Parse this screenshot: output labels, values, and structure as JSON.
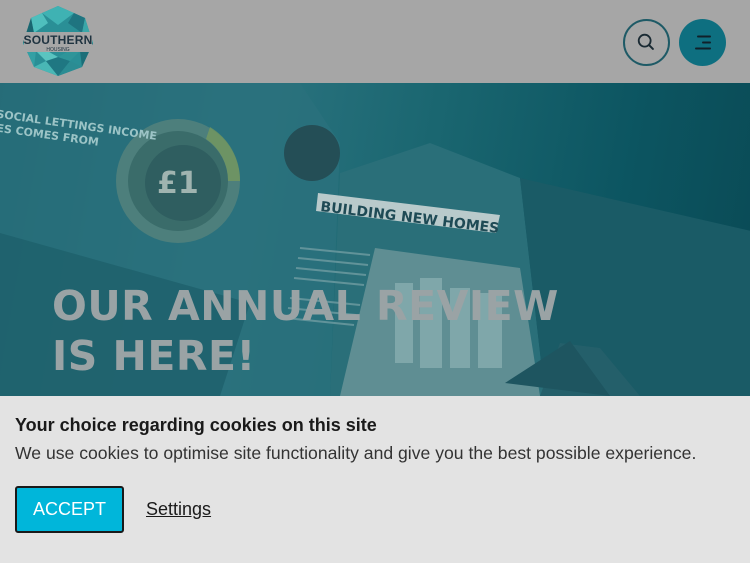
{
  "header": {
    "logo_text": "SOUTHERN",
    "logo_subtext": "HOUSING",
    "search_icon": "search-icon",
    "menu_icon": "menu-icon"
  },
  "hero": {
    "title": "OUR ANNUAL REVIEW IS HERE!",
    "image_text": {
      "heading": "BUILDING NEW HOMES",
      "coin_label": "£1",
      "side_text_1": "SOCIAL LETTINGS INCOME",
      "side_text_2": "ES COMES FROM"
    }
  },
  "cookie_banner": {
    "title": "Your choice regarding cookies on this site",
    "text": "We use cookies to optimise site functionality and give you the best possible experience.",
    "accept_label": "ACCEPT",
    "settings_label": "Settings"
  },
  "colors": {
    "header_bg": "#a6a6a6",
    "brand_teal": "#0e6f80",
    "accept_bg": "#00b6da",
    "banner_bg": "#e3e3e3"
  }
}
